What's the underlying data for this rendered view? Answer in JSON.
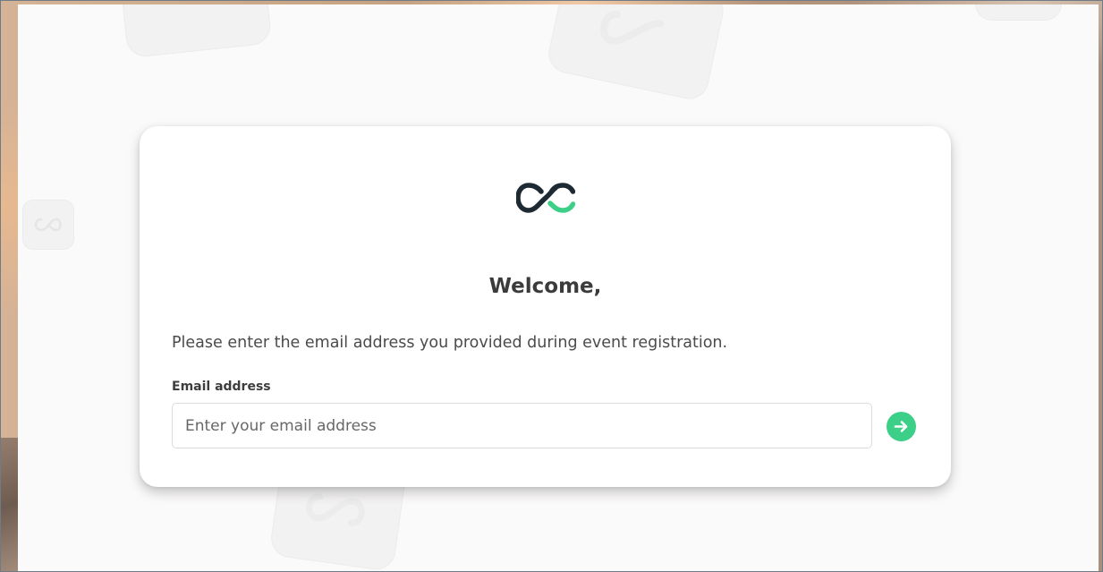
{
  "welcome": {
    "title": "Welcome,",
    "instructions": "Please enter the email address you provided during event registration."
  },
  "form": {
    "email_label": "Email address",
    "email_placeholder": "Enter your email address",
    "email_value": ""
  },
  "icons": {
    "logo": "infinity-logo-icon",
    "submit": "arrow-right-icon"
  },
  "colors": {
    "accent": "#3ccf87",
    "logo_dark": "#1e2a33",
    "text": "#3b3b3b"
  }
}
